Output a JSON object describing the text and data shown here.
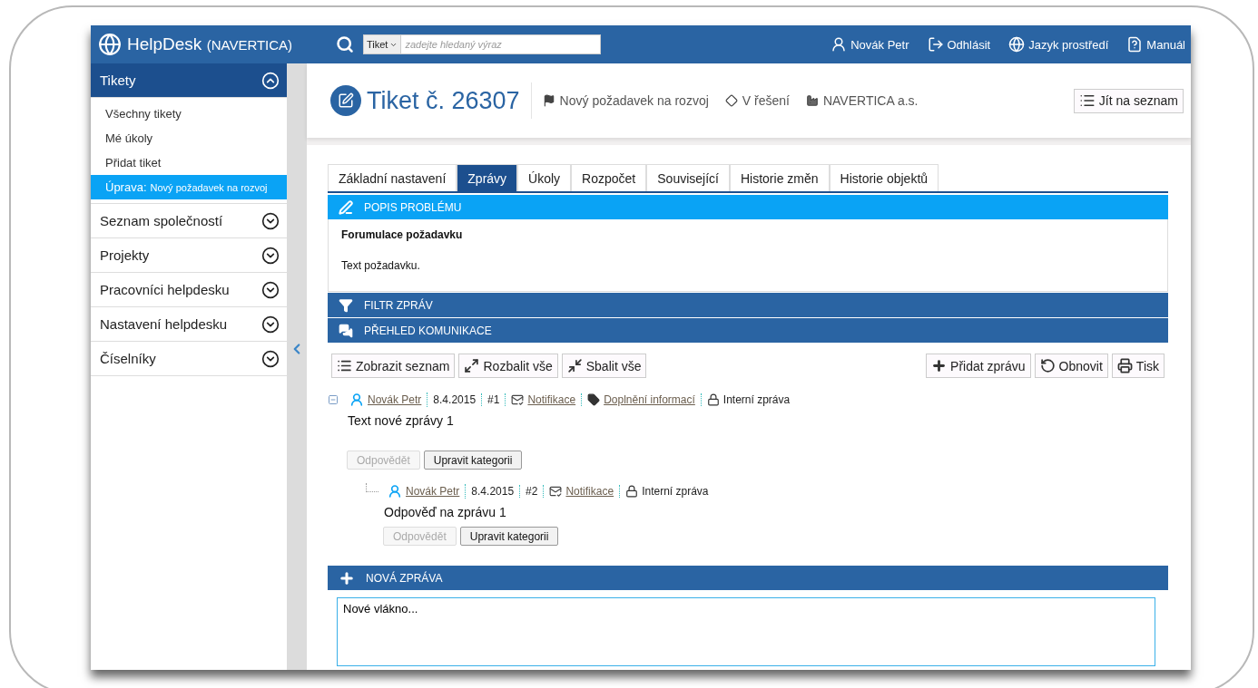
{
  "header": {
    "app_name": "HelpDesk",
    "app_suffix": "(NAVERTICA)",
    "search": {
      "scope": "Tiket",
      "placeholder": "zadejte hledaný výraz"
    },
    "links": [
      {
        "kind": "user",
        "label": "Novák Petr"
      },
      {
        "kind": "logout",
        "label": "Odhlásit"
      },
      {
        "kind": "language",
        "label": "Jazyk prostředí"
      },
      {
        "kind": "manual",
        "label": "Manuál"
      }
    ]
  },
  "sidebar": {
    "sections": [
      {
        "title": "Tikety",
        "expanded": true,
        "items": [
          {
            "label": "Všechny tikety",
            "selected": false
          },
          {
            "label": "Mé úkoly",
            "selected": false
          },
          {
            "label": "Přidat tiket",
            "selected": false
          },
          {
            "label": "Úprava:",
            "detail": "Nový požadavek na rozvoj",
            "selected": true
          }
        ]
      },
      {
        "title": "Seznam společností",
        "expanded": false
      },
      {
        "title": "Projekty",
        "expanded": false
      },
      {
        "title": "Pracovníci helpdesku",
        "expanded": false
      },
      {
        "title": "Nastavení helpdesku",
        "expanded": false
      },
      {
        "title": "Číselníky",
        "expanded": false
      }
    ]
  },
  "ticket": {
    "title": "Tiket č. 26307",
    "meta": [
      {
        "kind": "type",
        "text": "Nový požadavek na rozvoj"
      },
      {
        "kind": "status",
        "text": "V řešení"
      },
      {
        "kind": "company",
        "text": "NAVERTICA a.s."
      }
    ],
    "back_button": "Jít na seznam"
  },
  "tabs": [
    {
      "label": "Základní nastavení",
      "selected": false
    },
    {
      "label": "Zprávy",
      "selected": true
    },
    {
      "label": "Úkoly",
      "selected": false
    },
    {
      "label": "Rozpočet",
      "selected": false
    },
    {
      "label": "Související",
      "selected": false
    },
    {
      "label": "Historie změn",
      "selected": false
    },
    {
      "label": "Historie objektů",
      "selected": false
    }
  ],
  "problem": {
    "title": "POPIS PROBLÉMU",
    "heading": "Forumulace požadavku",
    "text": "Text požadavku."
  },
  "filter": {
    "title": "FILTR ZPRÁV"
  },
  "communication": {
    "title": "PŘEHLED KOMUNIKACE",
    "toolbar_left": [
      {
        "kind": "list",
        "label": "Zobrazit seznam"
      },
      {
        "kind": "expand",
        "label": "Rozbalit vše"
      },
      {
        "kind": "collapse",
        "label": "Sbalit vše"
      }
    ],
    "toolbar_right": [
      {
        "kind": "add",
        "label": "Přidat zprávu"
      },
      {
        "kind": "refresh",
        "label": "Obnovit"
      },
      {
        "kind": "print",
        "label": "Tisk"
      }
    ],
    "messages": [
      {
        "author": "Novák Petr",
        "date": "8.4.2015",
        "number": "#1",
        "notification": "Notifikace",
        "category": "Doplnění informací",
        "privacy": "Interní zpráva",
        "text": "Text nové zprávy 1",
        "expanded": true,
        "buttons": [
          {
            "label": "Odpovědět",
            "disabled": true
          },
          {
            "label": "Upravit kategorii",
            "disabled": false
          }
        ],
        "children": [
          {
            "author": "Novák Petr",
            "date": "8.4.2015",
            "number": "#2",
            "notification": "Notifikace",
            "privacy": "Interní zpráva",
            "text": "Odpověď na zprávu 1",
            "buttons": [
              {
                "label": "Odpovědět",
                "disabled": true
              },
              {
                "label": "Upravit kategorii",
                "disabled": false
              }
            ]
          }
        ]
      }
    ]
  },
  "new_message": {
    "title": "NOVÁ ZPRÁVA",
    "value": "Nové vlákno..."
  }
}
